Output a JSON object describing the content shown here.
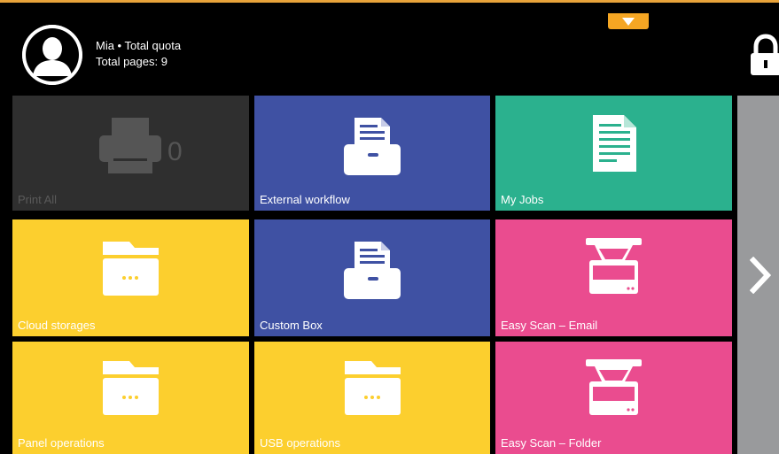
{
  "header": {
    "user_line": "Mia • Total quota",
    "pages_line": "Total pages: 9",
    "accent": "#e8a33a",
    "icons": {
      "avatar": "user-avatar-icon",
      "menu": "chevron-down-icon",
      "lock": "lock-icon"
    }
  },
  "tiles": [
    {
      "label": "Print All",
      "icon": "printer-icon",
      "count": "0",
      "color": "#2f2f2f",
      "enabled": false
    },
    {
      "label": "External workflow",
      "icon": "box-document-icon",
      "color": "#3f51a3"
    },
    {
      "label": "My Jobs",
      "icon": "document-icon",
      "color": "#2bb18e"
    },
    {
      "label": "Cloud storages",
      "icon": "folder-icon",
      "color": "#fccf2e"
    },
    {
      "label": "Custom Box",
      "icon": "box-document-icon",
      "color": "#3f51a3"
    },
    {
      "label": "Easy Scan – Email",
      "icon": "scanner-icon",
      "color": "#ea4c8f"
    },
    {
      "label": "Panel operations",
      "icon": "folder-icon",
      "color": "#fccf2e"
    },
    {
      "label": "USB operations",
      "icon": "folder-icon",
      "color": "#fccf2e"
    },
    {
      "label": "Easy Scan – Folder",
      "icon": "scanner-icon",
      "color": "#ea4c8f"
    }
  ],
  "nav": {
    "next_icon": "chevron-right-icon"
  }
}
